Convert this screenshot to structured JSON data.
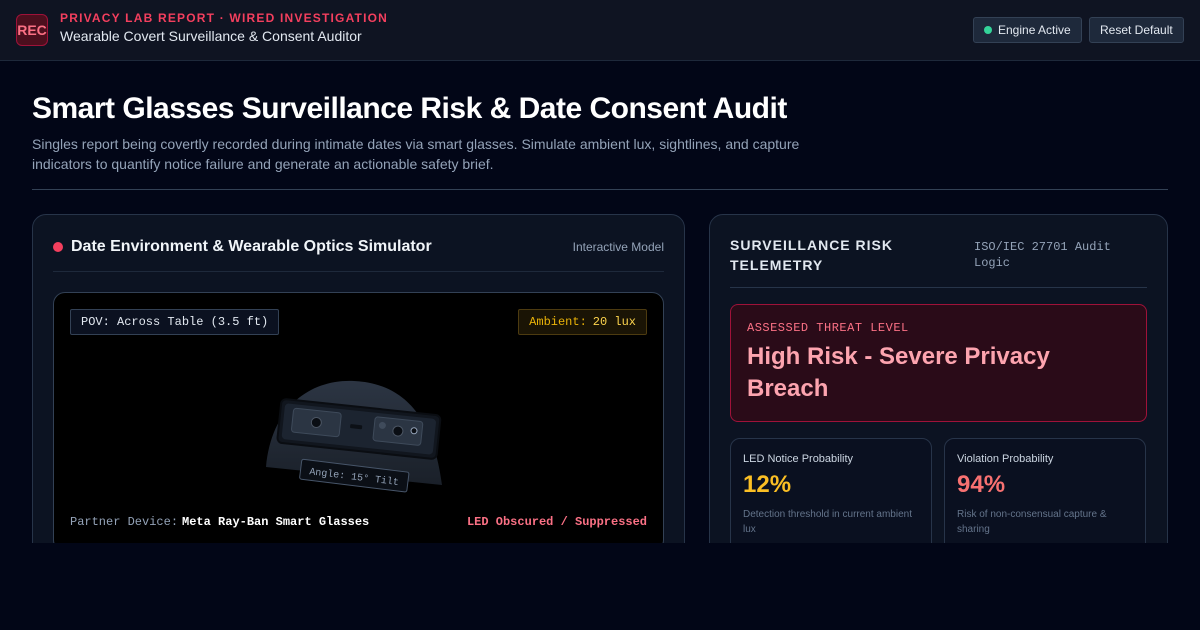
{
  "header": {
    "logo": "REC",
    "kicker": "PRIVACY LAB REPORT · WIRED INVESTIGATION",
    "title": "Wearable Covert Surveillance & Consent Auditor",
    "engine_label": "Engine Active",
    "reset_label": "Reset Default",
    "status_color": "#34d399"
  },
  "main": {
    "title": "Smart Glasses Surveillance Risk & Date Consent Audit",
    "description": "Singles report being covertly recorded during intimate dates via smart glasses. Simulate ambient lux, sightlines, and capture indicators to quantify notice failure and generate an actionable safety brief."
  },
  "simulator": {
    "title": "Date Environment & Wearable Optics Simulator",
    "tag": "Interactive Model",
    "pov": "POV: Across Table (3.5 ft)",
    "ambient_label": "Ambient:",
    "ambient_value": "20 lux",
    "angle_label": "Angle: 15° Tilt",
    "device_label": "Partner Device:",
    "device_name": "Meta Ray-Ban Smart Glasses",
    "led_status": "LED Obscured / Suppressed"
  },
  "telemetry": {
    "title": "SURVEILLANCE RISK TELEMETRY",
    "tag": "ISO/IEC 27701 Audit Logic",
    "threat_label": "ASSESSED THREAT LEVEL",
    "threat_value": "High Risk - Severe Privacy Breach",
    "metrics": [
      {
        "label": "LED Notice Probability",
        "value": "12%",
        "note": "Detection threshold in current ambient lux",
        "color": "#fbbf24"
      },
      {
        "label": "Violation Probability",
        "value": "94%",
        "note": "Risk of non-consensual capture & sharing",
        "color": "#f87171"
      }
    ]
  },
  "colors": {
    "accent": "#f43f5e",
    "background": "#020617",
    "panel": "#0c1322"
  }
}
